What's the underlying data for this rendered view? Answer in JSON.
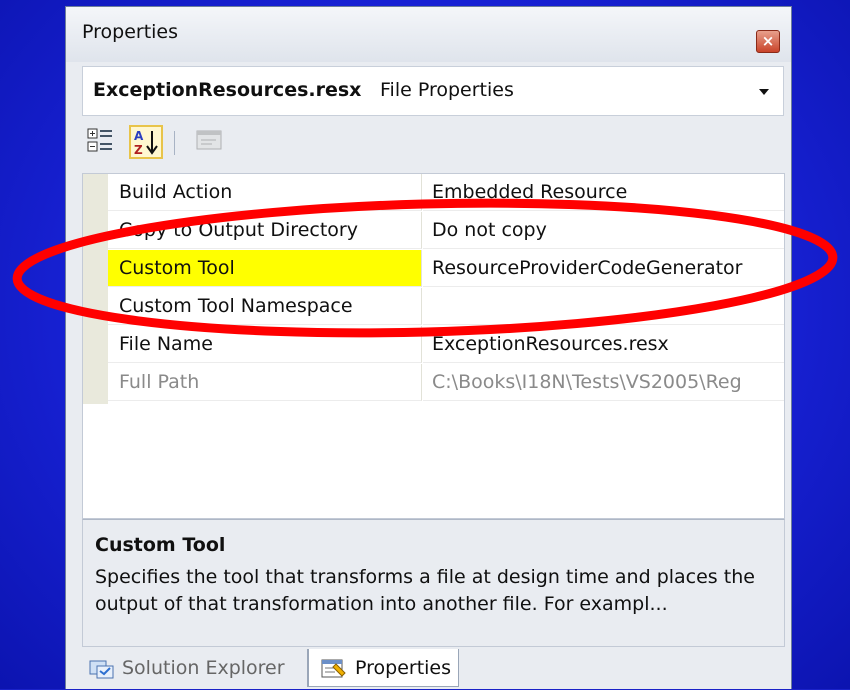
{
  "window": {
    "title": "Properties"
  },
  "object_selector": {
    "name": "ExceptionResources.resx",
    "type": "File Properties"
  },
  "toolbar": {
    "categorized_icon": "categorized-icon",
    "alphabetical_icon": "alphabetical-sort-icon",
    "property_pages_icon": "property-pages-icon"
  },
  "properties": [
    {
      "name": "Build Action",
      "value": "Embedded Resource"
    },
    {
      "name": "Copy to Output Directory",
      "value": "Do not copy"
    },
    {
      "name": "Custom Tool",
      "value": "ResourceProviderCodeGenerator",
      "selected": true
    },
    {
      "name": "Custom Tool Namespace",
      "value": ""
    },
    {
      "name": "File Name",
      "value": "ExceptionResources.resx"
    },
    {
      "name": "Full Path",
      "value": "C:\\Books\\I18N\\Tests\\VS2005\\Reg",
      "readonly": true
    }
  ],
  "description": {
    "title": "Custom Tool",
    "text": "Specifies the tool that transforms a file at design time and places the output of that transformation into another file. For exampl..."
  },
  "tabs": [
    {
      "label": "Solution Explorer",
      "icon": "solution-explorer-icon",
      "active": false
    },
    {
      "label": "Properties",
      "icon": "properties-icon",
      "active": true
    }
  ],
  "colors": {
    "background": "#1a22c8",
    "selection": "#ffff00",
    "annotation": "#ff0000"
  }
}
